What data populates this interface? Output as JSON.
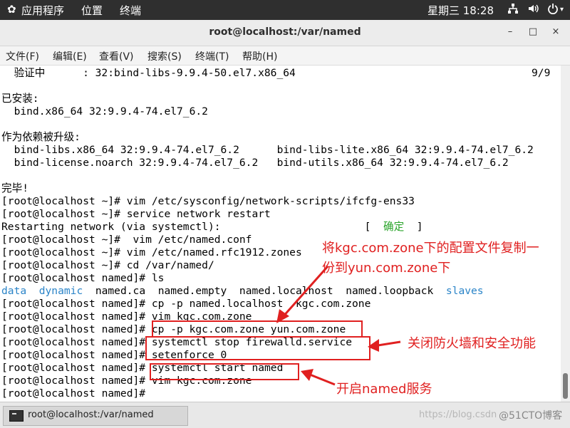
{
  "topbar": {
    "apps": "应用程序",
    "places": "位置",
    "terminal": "终端",
    "datetime": "星期三 18:28",
    "icons": [
      "network-icon",
      "volume-icon",
      "power-icon"
    ]
  },
  "window": {
    "title": "root@localhost:/var/named",
    "controls": {
      "minimize": "–",
      "maximize": "□",
      "close": "×"
    }
  },
  "menu": {
    "file": "文件(F)",
    "edit": "编辑(E)",
    "view": "查看(V)",
    "search": "搜索(S)",
    "terminal": "终端(T)",
    "help": "帮助(H)"
  },
  "terminal": {
    "l1a": "  验证中      : 32:bind-libs-9.9.4-50.el7.x86_64",
    "l1b": "9/9",
    "l3": "已安装:",
    "l4": "  bind.x86_64 32:9.9.4-74.el7_6.2",
    "l6": "作为依赖被升级:",
    "l7": "  bind-libs.x86_64 32:9.9.4-74.el7_6.2      bind-libs-lite.x86_64 32:9.9.4-74.el7_6.2",
    "l8": "  bind-license.noarch 32:9.9.4-74.el7_6.2   bind-utils.x86_64 32:9.9.4-74.el7_6.2",
    "l10": "完毕!",
    "l11": "[root@localhost ~]# vim /etc/sysconfig/network-scripts/ifcfg-ens33",
    "l12": "[root@localhost ~]# service network restart",
    "l13a": "Restarting network (via systemctl):                       [  ",
    "l13ok": "确定",
    "l13b": "  ]",
    "l14": "[root@localhost ~]#  vim /etc/named.conf",
    "l15": "[root@localhost ~]# vim /etc/named.rfc1912.zones",
    "l16": "[root@localhost ~]# cd /var/named/",
    "l17": "[root@localhost named]# ls",
    "l18a": "data",
    "l18b": "dynamic",
    "l18c": "named.ca  named.empty  named.localhost  named.loopback",
    "l18d": "slaves",
    "l19": "[root@localhost named]# cp -p named.localhost  kgc.com.zone",
    "l20": "[root@localhost named]# vim kgc.com.zone",
    "l21": "[root@localhost named]# cp -p kgc.com.zone yun.com.zone",
    "l22": "[root@localhost named]# systemctl stop firewalld.service",
    "l23": "[root@localhost named]# setenforce 0",
    "l24": "[root@localhost named]# systemctl start named",
    "l25": "[root@localhost named]# vim kgc.com.zone",
    "l26": "[root@localhost named]# "
  },
  "annotations": {
    "note1_line1": "将kgc.com.zone下的配置文件复制一",
    "note1_line2": "份到yun.com.zone下",
    "note2": "关闭防火墙和安全功能",
    "note3": "开启named服务",
    "color": "#e02020"
  },
  "taskbar": {
    "task_label": "root@localhost:/var/named",
    "watermark_url": "https://blog.csdn",
    "watermark_brand": "@51CTO博客"
  },
  "colors": {
    "dir_color": "#2a84c8",
    "ok_color": "#27a327",
    "topbar_bg": "#2f2f2f"
  }
}
